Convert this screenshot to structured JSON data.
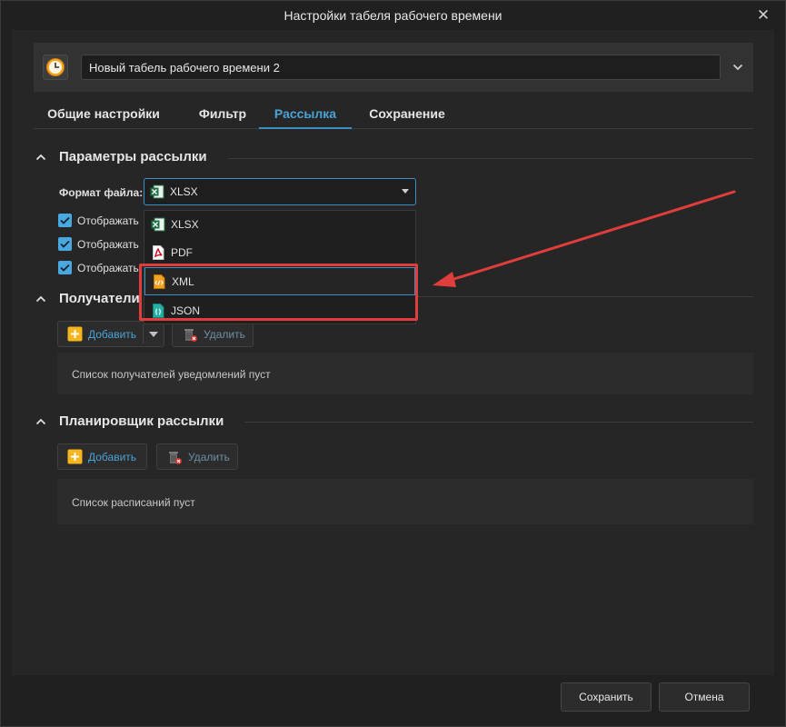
{
  "window": {
    "title": "Настройки табеля рабочего времени",
    "close_glyph": "✕"
  },
  "header": {
    "name_value": "Новый табель рабочего времени 2"
  },
  "tabs": [
    {
      "label": "Общие настройки",
      "active": false
    },
    {
      "label": "Фильтр",
      "active": false
    },
    {
      "label": "Рассылка",
      "active": true
    },
    {
      "label": "Сохранение",
      "active": false
    }
  ],
  "sections": {
    "params": {
      "title": "Параметры рассылки"
    },
    "recipients": {
      "title": "Получатели"
    },
    "scheduler": {
      "title": "Планировщик рассылки"
    }
  },
  "file_format": {
    "label": "Формат файла:",
    "selected": "XLSX",
    "options": [
      {
        "label": "XLSX",
        "icon": "excel-icon"
      },
      {
        "label": "PDF",
        "icon": "pdf-icon"
      },
      {
        "label": "XML",
        "icon": "xml-icon"
      },
      {
        "label": "JSON",
        "icon": "json-icon"
      }
    ]
  },
  "checkboxes": [
    {
      "label": "Отображать",
      "checked": true
    },
    {
      "label": "Отображать",
      "checked": true
    },
    {
      "label": "Отображать",
      "checked": true
    }
  ],
  "recipients": {
    "add_label": "Добавить",
    "delete_label": "Удалить",
    "empty_text": "Список получателей уведомлений пуст"
  },
  "scheduler": {
    "add_label": "Добавить",
    "delete_label": "Удалить",
    "empty_text": "Список расписаний пуст"
  },
  "footer": {
    "save_label": "Сохранить",
    "cancel_label": "Отмена"
  },
  "colors": {
    "accent": "#3b8fc2",
    "highlight": "#e23d3d",
    "background": "#262626"
  }
}
